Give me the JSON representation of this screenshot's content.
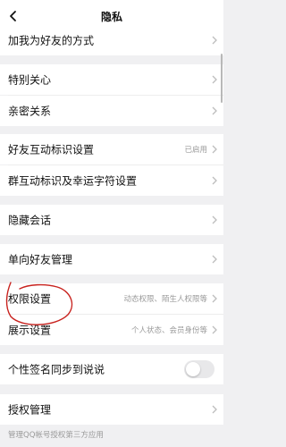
{
  "header": {
    "title": "隐私"
  },
  "rows": [
    {
      "label": "加我为好友的方式"
    },
    {
      "label": "特别关心"
    },
    {
      "label": "亲密关系"
    },
    {
      "label": "好友互动标识设置",
      "value": "已启用"
    },
    {
      "label": "群互动标识及幸运字符设置"
    },
    {
      "label": "隐藏会话"
    },
    {
      "label": "单向好友管理"
    },
    {
      "label": "权限设置",
      "value": "动态权限、陌生人权限等"
    },
    {
      "label": "展示设置",
      "value": "个人状态、会员身份等"
    },
    {
      "label": "个性签名同步到说说",
      "toggle": false
    },
    {
      "label": "授权管理"
    }
  ],
  "footer_note": "管理QQ帐号授权第三方应用",
  "colors": {
    "annotation_circle": "#c8221e",
    "background": "#f0f0f2"
  }
}
